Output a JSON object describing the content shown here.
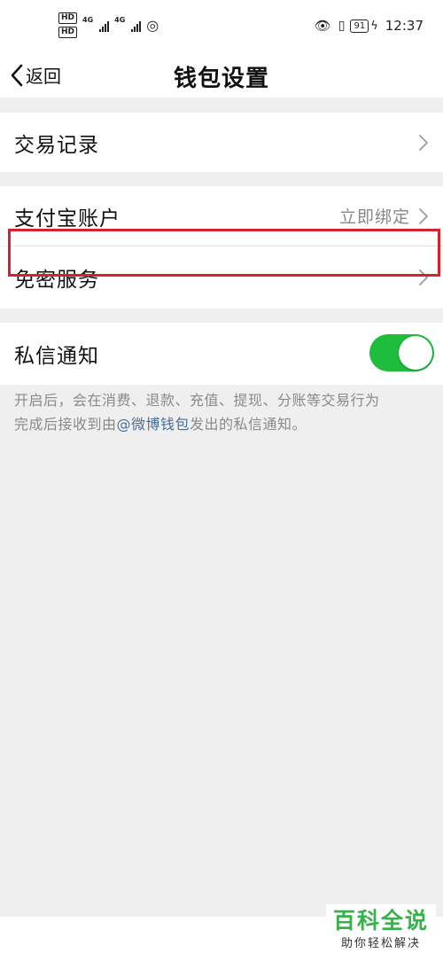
{
  "status_bar": {
    "hd1": "HD",
    "hd2": "HD",
    "net1": "4G",
    "net2": "4G",
    "battery": "91",
    "time": "12:37"
  },
  "nav": {
    "back_label": "返回",
    "title": "钱包设置"
  },
  "rows": {
    "transactions": "交易记录",
    "alipay_label": "支付宝账户",
    "alipay_value": "立即绑定",
    "password_free": "免密服务",
    "private_notice": "私信通知"
  },
  "private_notice_toggle_on": true,
  "description": {
    "line1": "开启后，会在消费、退款、充值、提现、分账等交易行为",
    "line2_prefix": "完成后接收到由",
    "line2_link": "@微博钱包",
    "line2_suffix": "发出的私信通知。"
  },
  "watermark": {
    "main": "百科全说",
    "sub": "助你轻松解决"
  },
  "colors": {
    "toggle_on": "#1fbd3e",
    "highlight": "#d6222e",
    "link": "#4a6e95",
    "watermark": "#36b24a"
  }
}
